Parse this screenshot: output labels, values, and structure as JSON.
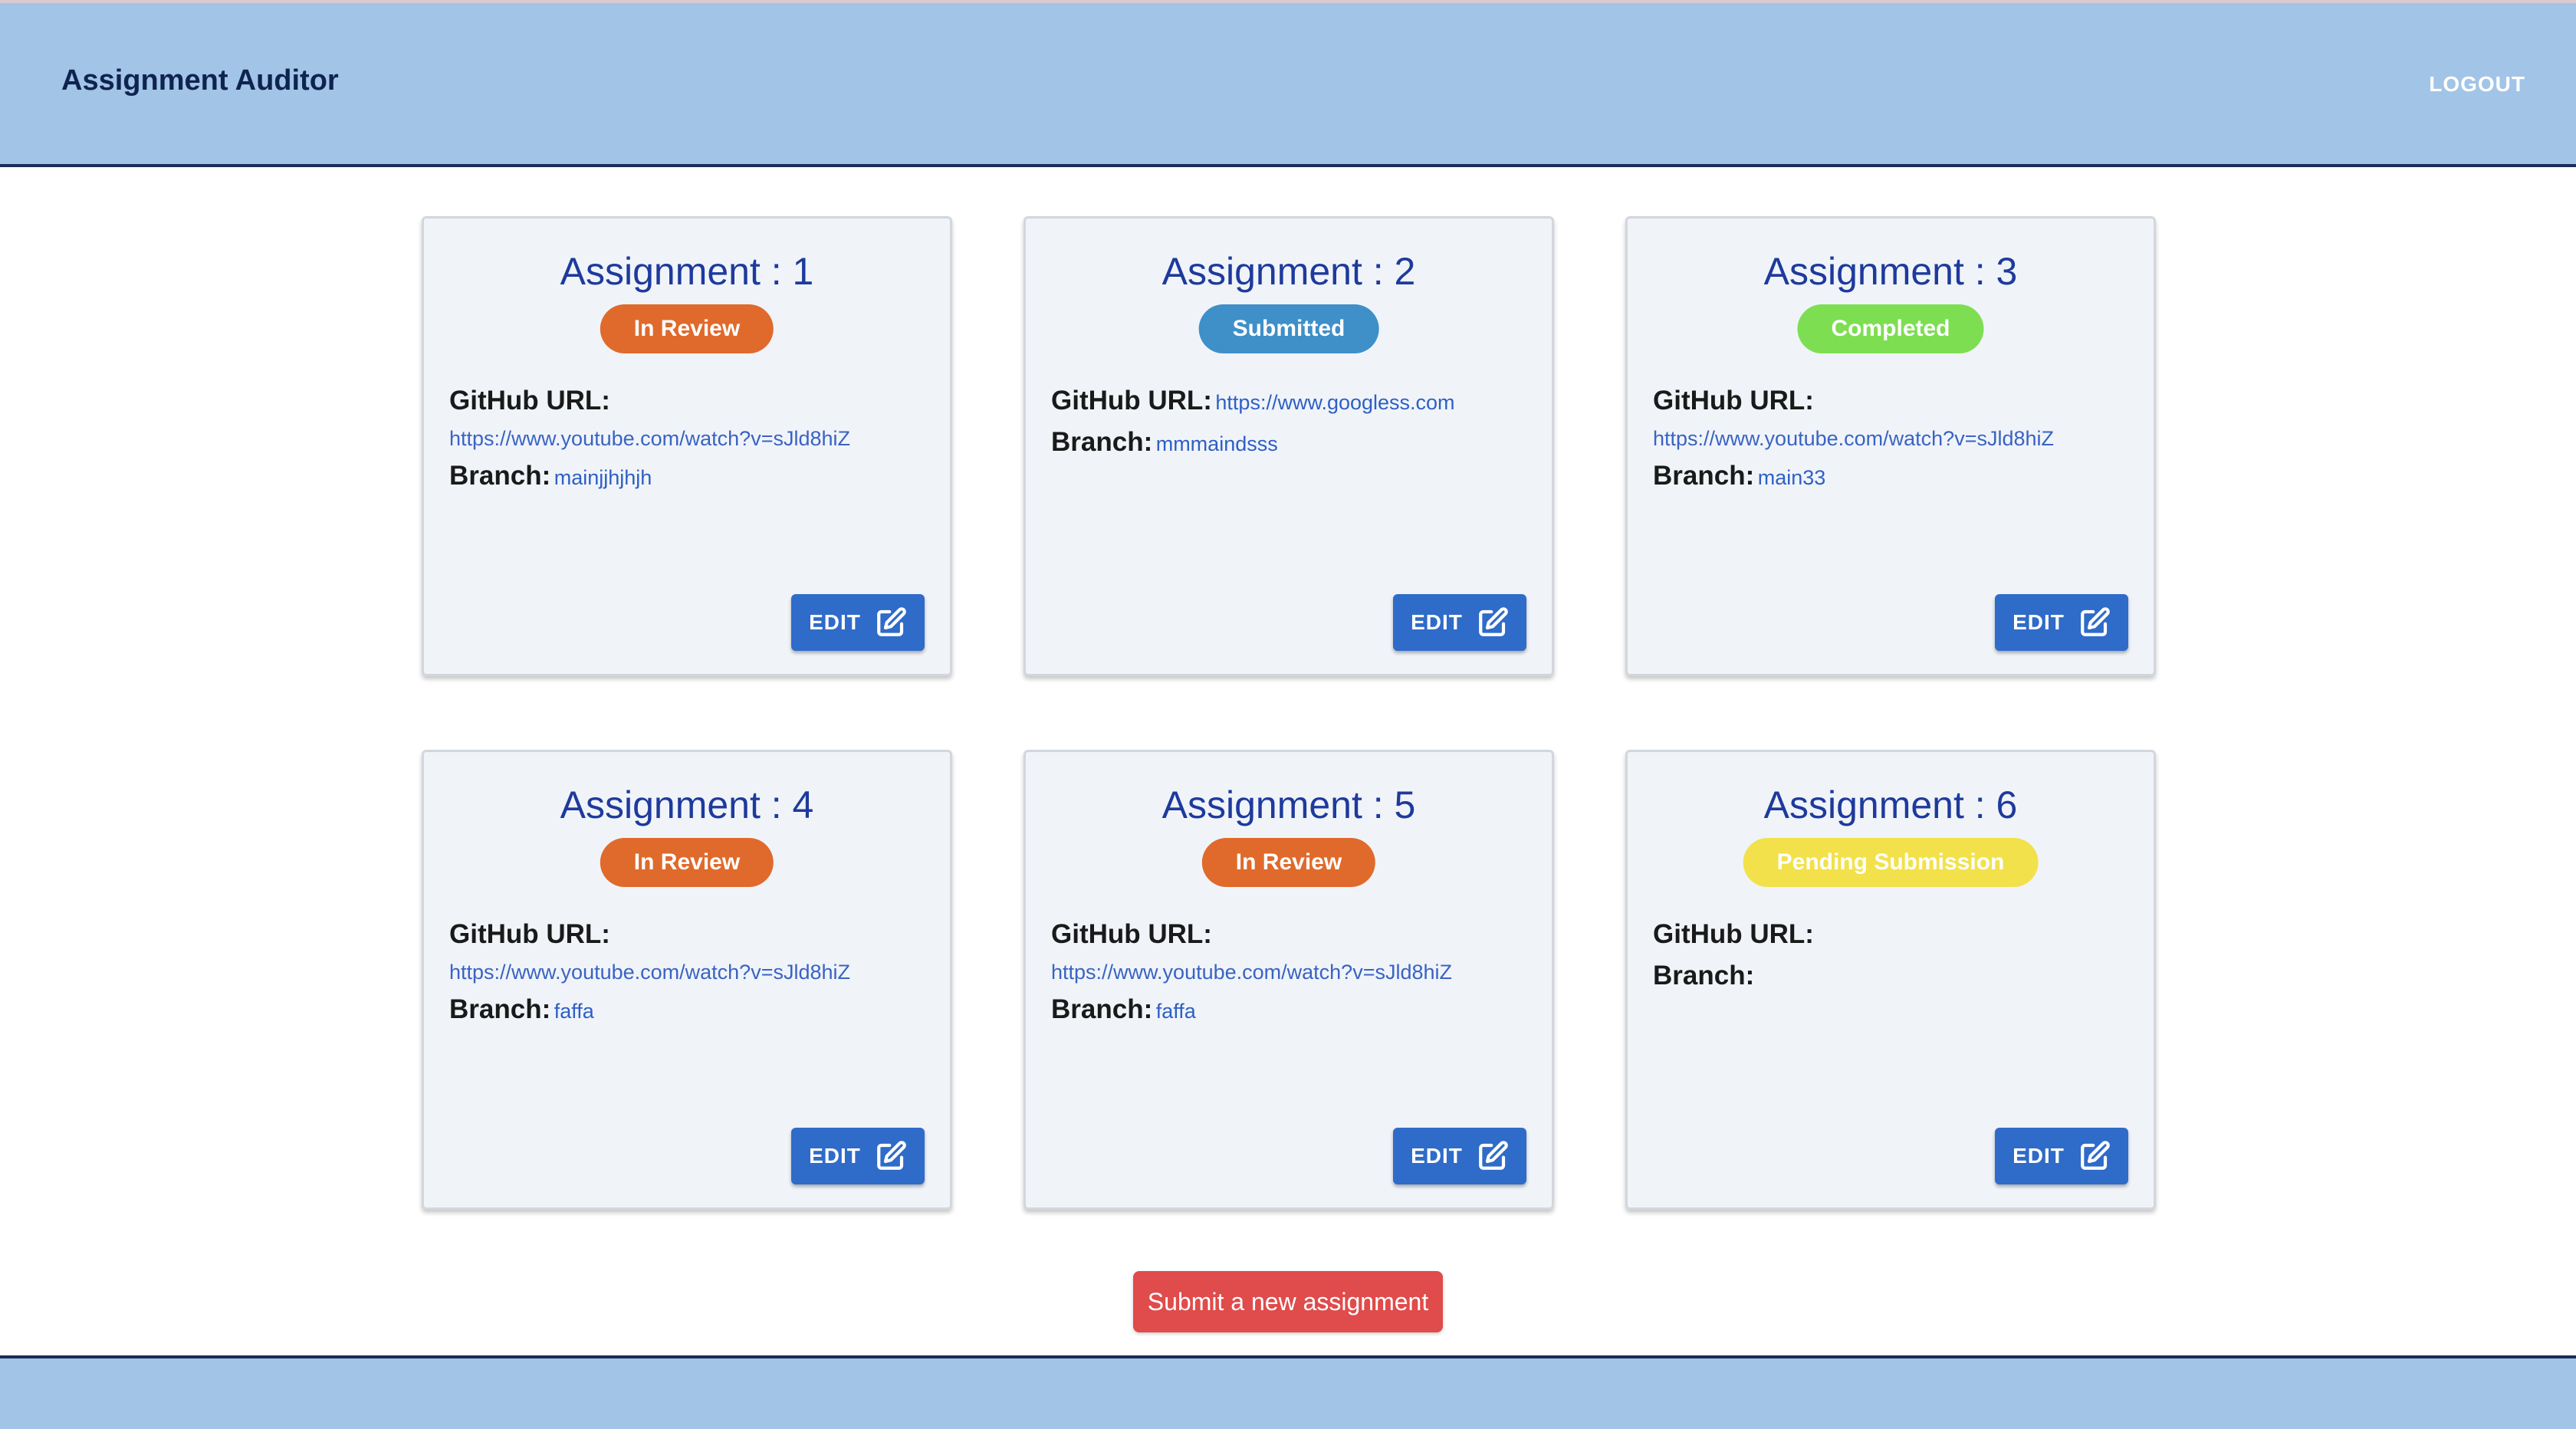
{
  "app": {
    "title": "Assignment Auditor",
    "logout_label": "LOGOUT"
  },
  "labels": {
    "github": "GitHub URL:",
    "branch": "Branch:",
    "edit": "EDIT"
  },
  "status_colors": {
    "In Review": "#e06a2b",
    "Submitted": "#3f8fc9",
    "Completed": "#7dde52",
    "Pending Submission": "#f2e14a"
  },
  "assignments": [
    {
      "title": "Assignment : 1",
      "status": "In Review",
      "github_url": "https://www.youtube.com/watch?v=sJld8hiZ",
      "branch": "mainjjhjhjh"
    },
    {
      "title": "Assignment : 2",
      "status": "Submitted",
      "github_url": "https://www.googless.com",
      "branch": "mmmaindsss"
    },
    {
      "title": "Assignment : 3",
      "status": "Completed",
      "github_url": "https://www.youtube.com/watch?v=sJld8hiZ",
      "branch": "main33"
    },
    {
      "title": "Assignment : 4",
      "status": "In Review",
      "github_url": "https://www.youtube.com/watch?v=sJld8hiZ",
      "branch": "faffa"
    },
    {
      "title": "Assignment : 5",
      "status": "In Review",
      "github_url": "https://www.youtube.com/watch?v=sJld8hiZ",
      "branch": "faffa"
    },
    {
      "title": "Assignment : 6",
      "status": "Pending Submission",
      "github_url": "",
      "branch": ""
    }
  ],
  "actions": {
    "submit_new_label": "Submit a new assignment"
  }
}
